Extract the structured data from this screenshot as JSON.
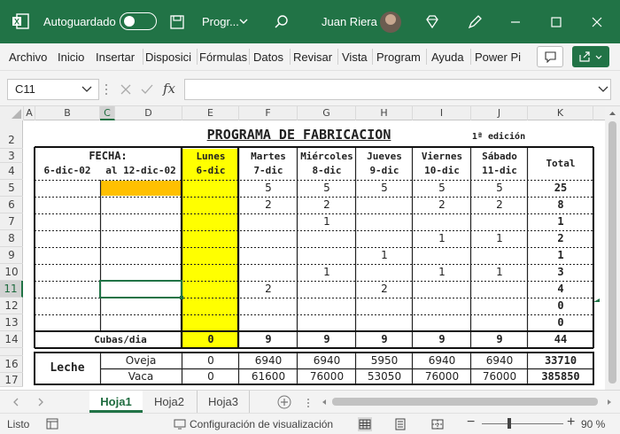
{
  "titlebar": {
    "autosave_label": "Autoguardado",
    "doc_name": "Progr...",
    "user": "Juan Riera"
  },
  "ribbon": {
    "tabs": [
      "Archivo",
      "Inicio",
      "Insertar",
      "Disposici",
      "Fórmulas",
      "Datos",
      "Revisar",
      "Vista",
      "Program",
      "Ayuda",
      "Power Pi"
    ]
  },
  "formula_bar": {
    "namebox": "C11",
    "fx": "fx",
    "content": ""
  },
  "columns": [
    "A",
    "B",
    "C",
    "D",
    "E",
    "F",
    "G",
    "H",
    "I",
    "J",
    "K"
  ],
  "rows": [
    "2",
    "3",
    "4",
    "5",
    "6",
    "7",
    "8",
    "9",
    "10",
    "11",
    "12",
    "13",
    "14",
    "16",
    "17"
  ],
  "sheet": {
    "title": "PROGRAMA DE FABRICACION",
    "edition": "1ª edición",
    "fecha_label": "FECHA:",
    "fecha_from": "6-dic-02",
    "fecha_to": "al  12-dic-02",
    "days": [
      {
        "name": "Lunes",
        "date": "6-dic"
      },
      {
        "name": "Martes",
        "date": "7-dic"
      },
      {
        "name": "Miércoles",
        "date": "8-dic"
      },
      {
        "name": "Jueves",
        "date": "9-dic"
      },
      {
        "name": "Viernes",
        "date": "10-dic"
      },
      {
        "name": "Sábado",
        "date": "11-dic"
      }
    ],
    "total_label": "Total",
    "grid": [
      [
        "",
        "5",
        "5",
        "5",
        "5",
        "5",
        "25"
      ],
      [
        "",
        "2",
        "2",
        "",
        "2",
        "2",
        "8"
      ],
      [
        "",
        "",
        "1",
        "",
        "",
        "",
        "1"
      ],
      [
        "",
        "",
        "",
        "",
        "1",
        "1",
        "2"
      ],
      [
        "",
        "",
        "",
        "1",
        "",
        "",
        "1"
      ],
      [
        "",
        "",
        "1",
        "",
        "1",
        "1",
        "3"
      ],
      [
        "",
        "2",
        "",
        "2",
        "",
        "",
        "4"
      ],
      [
        "",
        "",
        "",
        "",
        "",
        "",
        "0"
      ],
      [
        "",
        "",
        "",
        "",
        "",
        "",
        "0"
      ]
    ],
    "cubas_label": "Cubas/dia",
    "cubas": [
      "0",
      "9",
      "9",
      "9",
      "9",
      "9",
      "44"
    ],
    "leche_label": "Leche",
    "oveja_label": "Oveja",
    "oveja": [
      "0",
      "6940",
      "6940",
      "5950",
      "6940",
      "6940",
      "33710"
    ],
    "vaca_label": "Vaca",
    "vaca": [
      "0",
      "61600",
      "76000",
      "53050",
      "76000",
      "76000",
      "385850"
    ]
  },
  "sheets": [
    "Hoja1",
    "Hoja2",
    "Hoja3"
  ],
  "status": {
    "ready": "Listo",
    "view_settings": "Configuración de visualización",
    "zoom": "90 %"
  },
  "colors": {
    "accent": "#217346",
    "yellow": "#ffff00",
    "orange": "#ffc000"
  }
}
